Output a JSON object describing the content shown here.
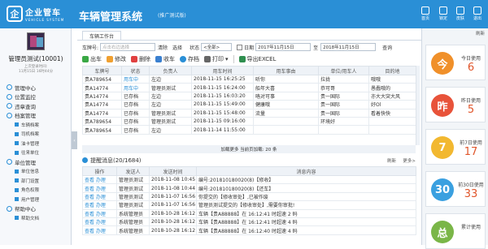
{
  "header": {
    "logo_mark": "企",
    "logo_cn": "企业管车",
    "logo_en": "VEHICLE SYSTEM",
    "title": "车辆管理系统",
    "subtitle": "(推广测试版)",
    "tools": [
      "首页",
      "锁定",
      "皮肤",
      "退出"
    ]
  },
  "sidebar": {
    "user_name": "管理员测试(10001)",
    "last_login_label": "上次登录时间:",
    "last_login": "11月15日 16时44分",
    "nav": [
      {
        "label": "管理中心",
        "type": "item"
      },
      {
        "label": "位置监控",
        "type": "item"
      },
      {
        "label": "违章查询",
        "type": "item"
      },
      {
        "label": "档案管理",
        "type": "item"
      },
      {
        "label": "车辆档案",
        "type": "sub"
      },
      {
        "label": "司机档案",
        "type": "sub"
      },
      {
        "label": "油卡管理",
        "type": "sub"
      },
      {
        "label": "往来单位",
        "type": "sub"
      },
      {
        "label": "单位管理",
        "type": "item"
      },
      {
        "label": "单位信息",
        "type": "sub"
      },
      {
        "label": "部门设置",
        "type": "sub"
      },
      {
        "label": "角色权限",
        "type": "sub"
      },
      {
        "label": "用户管理",
        "type": "sub"
      },
      {
        "label": "帮助中心",
        "type": "item"
      },
      {
        "label": "帮助文档",
        "type": "sub"
      }
    ]
  },
  "tab": {
    "label": "车辆工作台"
  },
  "filter": {
    "plate_label": "车牌号:",
    "plate_placeholder": "点击右边选择",
    "clear": "清除",
    "select": "选择",
    "status_label": "状态",
    "status_value": "<全部>",
    "date_label": "日期",
    "date_from": "2017年11月15日",
    "to": "至",
    "date_to": "2018年11月15日",
    "query": "查询"
  },
  "toolbar": {
    "out": "出车",
    "edit": "修改",
    "delete": "删除",
    "return": "收车",
    "archive": "存档",
    "print": "打印",
    "export": "导出EXCEL"
  },
  "vehicle_table": {
    "columns": [
      "车牌号",
      "状态",
      "负责人",
      "用车时间",
      "用车事由",
      "单位/用车人",
      "目的地"
    ],
    "rows": [
      [
        "贵A789654",
        "用车中",
        "左边",
        "2018-11-15 16:25:25",
        "听你",
        "拉拢",
        "哦哦"
      ],
      [
        "贵A14774",
        "用车中",
        "管理员测试",
        "2018-11-15 16:24:00",
        "船年大喜",
        "恭可哥",
        "愚蠢哦的"
      ],
      [
        "贵A14774",
        "已存档",
        "左边",
        "2018-11-15 16:03:20",
        "咯对可事",
        "贵一国际",
        "亦大大突大风"
      ],
      [
        "贵A14774",
        "已存档",
        "左边",
        "2018-11-15 15:49:00",
        "健康哦",
        "贵一国际",
        "好Ol"
      ],
      [
        "贵A14774",
        "已存档",
        "管理员测试",
        "2018-11-15 15:48:00",
        "流量",
        "贵一国际",
        "看着快快"
      ],
      [
        "贵A789654",
        "已存档",
        "管理员测试",
        "2018-11-15 09:16:00",
        "",
        "环境好",
        ""
      ],
      [
        "贵A789654",
        "已存档",
        "左边",
        "2018-11-14 11:55:00",
        "",
        "",
        ""
      ]
    ],
    "footer": "加载更多  当前页加载: 20 条"
  },
  "messages": {
    "title": "提醒消息(20/1684)",
    "refresh": "刷新",
    "more": "更多>",
    "columns": [
      "操作",
      "发送人",
      "发送时间",
      "消息内容"
    ],
    "rows": [
      [
        "查看 办理",
        "管理员测试",
        "2018-11-08 10:45",
        "编号:201810180020(8)【修收】"
      ],
      [
        "查看 办理",
        "管理员测试",
        "2018-11-08 10:44",
        "编号:201810180020(8)【还车】"
      ],
      [
        "查看 办理",
        "管理员测试",
        "2018-11-07 16:56",
        "你提交的【修收审处】,已被作废"
      ],
      [
        "查看 办理",
        "管理员测试",
        "2018-11-07 16:56",
        "管理员测试提交的【修收审处】,需要你审批!"
      ],
      [
        "查看 办理",
        "系统管理员",
        "2018-10-28 16:12",
        "车辆【贵A88888】在 16:12:41 时超速 2 码"
      ],
      [
        "查看 办理",
        "系统管理员",
        "2018-10-28 16:12",
        "车辆【贵A88888】在 16:12:41 时超速 4 码"
      ],
      [
        "查看 办理",
        "系统管理员",
        "2018-10-28 16:12",
        "车辆【贵A88888】在 16:12:40 时超速 4 码"
      ]
    ]
  },
  "right_panel": {
    "refresh": "刷新",
    "stats": [
      {
        "glyph": "今",
        "label": "今日使用",
        "value": "6",
        "color": "#f0902a"
      },
      {
        "glyph": "昨",
        "label": "昨日使用",
        "value": "5",
        "color": "#e8533a"
      },
      {
        "glyph": "7",
        "label": "前7日使用",
        "value": "17",
        "color": "#f2b830"
      },
      {
        "glyph": "30",
        "label": "前30日使用",
        "value": "33",
        "color": "#3aa0e0"
      },
      {
        "glyph": "总",
        "label": "累计使用",
        "value": "",
        "color": "#7ab648"
      }
    ]
  }
}
